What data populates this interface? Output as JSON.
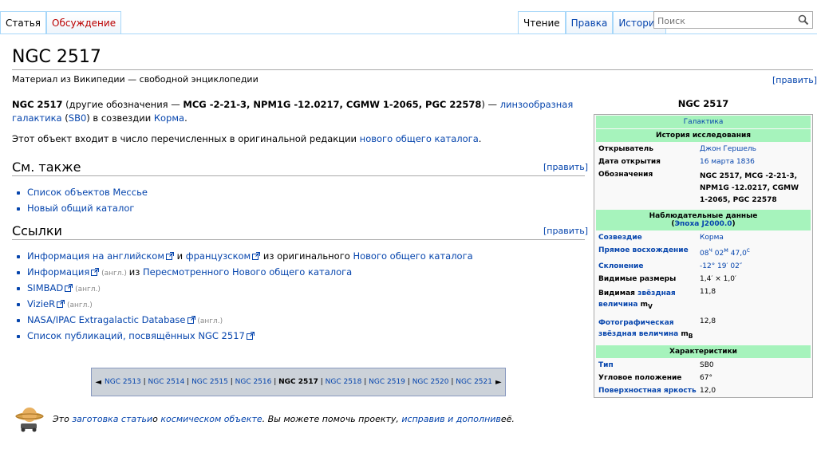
{
  "tabs_left": [
    "Статья",
    "Обсуждение"
  ],
  "tabs_right": [
    "Чтение",
    "Правка",
    "История"
  ],
  "search": {
    "placeholder": "Поиск"
  },
  "page": {
    "title": "NGC 2517",
    "subtitle": "Материал из Википедии — свободной энциклопедии",
    "edit": "[править]"
  },
  "intro": {
    "p1_bold": "NGC 2517",
    "p1_text1": " (другие обозначения — ",
    "p1_bold2": "MCG -2-21-3, NPM1G -12.0217, CGMW 1-2065, PGC 22578",
    "p1_text2": ") — ",
    "p1_link1": "линзообразная галактика",
    "p1_text3": " (",
    "p1_link2": "SB0",
    "p1_text4": ") в созвездии ",
    "p1_link3": "Корма",
    "p1_text5": ".",
    "p2_text": "Этот объект входит в число перечисленных в оригинальной редакции ",
    "p2_link": "нового общего каталога",
    "p2_end": "."
  },
  "see_also": {
    "heading": "См. также",
    "edit": "[править]",
    "items": [
      "Список объектов Мессье",
      "Новый общий каталог"
    ]
  },
  "links": {
    "heading": "Ссылки",
    "edit": "[править]",
    "i1_a": "Информация на английском",
    "i1_b": " и ",
    "i1_c": "французском",
    "i1_d": " из оригинального ",
    "i1_e": "Нового общего каталога",
    "i2_a": "Информация",
    "i2_lang": " (англ.) ",
    "i2_b": "из ",
    "i2_c": "Пересмотренного Нового общего каталога",
    "i3": "SIMBAD",
    "i3_lang": " (англ.)",
    "i4": "VizieR",
    "i4_lang": " (англ.)",
    "i5": "NASA/IPAC Extragalactic Database",
    "i5_lang": " (англ.)",
    "i6": "Список публикаций, посвящённых NGC 2517"
  },
  "navbox": {
    "prev_arrow": "◄",
    "next_arrow": "►",
    "items": [
      "NGC 2513",
      "NGC 2514",
      "NGC 2515",
      "NGC 2516",
      "NGC 2517",
      "NGC 2518",
      "NGC 2519",
      "NGC 2520",
      "NGC 2521"
    ],
    "current": "NGC 2517"
  },
  "stub": {
    "t1": "Это ",
    "l1": "заготовка статьи",
    "t2": " о ",
    "l2": "космическом объекте",
    "t3": ". Вы можете помочь проекту, ",
    "l3": "исправив и дополнив",
    "t4": " её."
  },
  "infobox": {
    "title": "NGC 2517",
    "type_head": "Галактика",
    "history_head": "История исследования",
    "discoverer_k": "Открыватель",
    "discoverer_v": "Джон Гершель",
    "date_k": "Дата открытия",
    "date_v": "16 марта 1836",
    "desig_k": "Обозначения",
    "desig_v": "NGC 2517, MCG -2-21-3, NPM1G -12.0217, CGMW 1-2065, PGC 22578",
    "obs_head": "Наблюдательные данные",
    "epoch_a": "(",
    "epoch_link": "Эпоха J2000.0",
    "epoch_b": ")",
    "const_k": "Созвездие",
    "const_v": "Корма",
    "ra_k": "Прямое восхождение",
    "ra_h": "08",
    "ra_hs": "ч",
    "ra_m": " 02",
    "ra_ms": "м",
    "ra_s": " 47,0",
    "ra_ss": "с",
    "dec_k": "Склонение",
    "dec_v": "-12° 19′ 02″",
    "size_k": "Видимые размеры",
    "size_v": "1,4′ × 1,0′",
    "vmag_k1": "Видимая ",
    "vmag_k2": "звёздная величина",
    "vmag_k3": " m",
    "vmag_sub": "V",
    "vmag_v": "11,8",
    "pmag_k1": "Фотографическая звёздная величина",
    "pmag_k2": " m",
    "pmag_sub": "B",
    "pmag_v": "12,8",
    "char_head": "Характеристики",
    "type_k": "Тип",
    "type_v": "SB0",
    "pa_k": "Угловое положение",
    "pa_v": "67°",
    "sb_k": "Поверхностная яркость",
    "sb_v": "12,0"
  }
}
